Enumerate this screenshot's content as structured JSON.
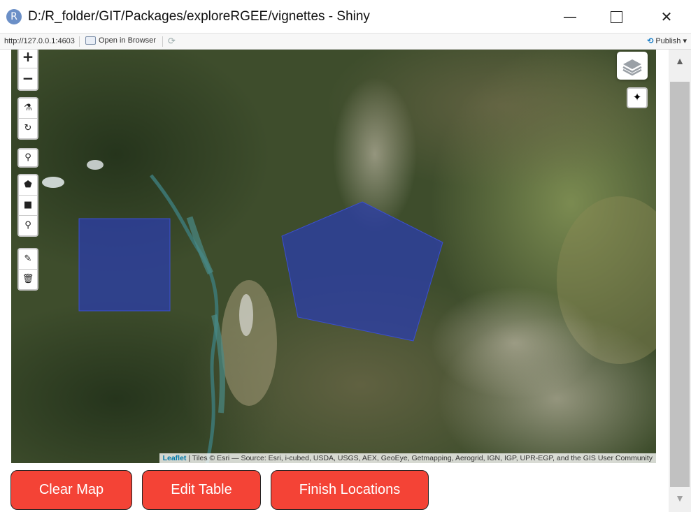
{
  "window": {
    "title": "D:/R_folder/GIT/Packages/exploreRGEE/vignettes - Shiny",
    "app_icon_letter": "R",
    "minimize_glyph": "—",
    "close_glyph": "✕"
  },
  "toolbar": {
    "url": "http://127.0.0.1:4603",
    "open_browser": "Open in Browser",
    "publish": "Publish",
    "publish_caret": "▾"
  },
  "map": {
    "zoom_in": "+",
    "zoom_out": "−",
    "attribution_link": "Leaflet",
    "attribution_text": " | Tiles © Esri — Source: Esri, i-cubed, USDA, USGS, AEX, GeoEye, Getmapping, Aerogrid, IGN, IGP, UPR-EGP, and the GIS User Community",
    "shape_fill_color": "#2c3ea6"
  },
  "scrollbar": {
    "up_arrow": "▲",
    "down_arrow": "▼"
  },
  "buttons": {
    "clear_map": "Clear Map",
    "edit_table": "Edit Table",
    "finish_locations": "Finish Locations"
  }
}
